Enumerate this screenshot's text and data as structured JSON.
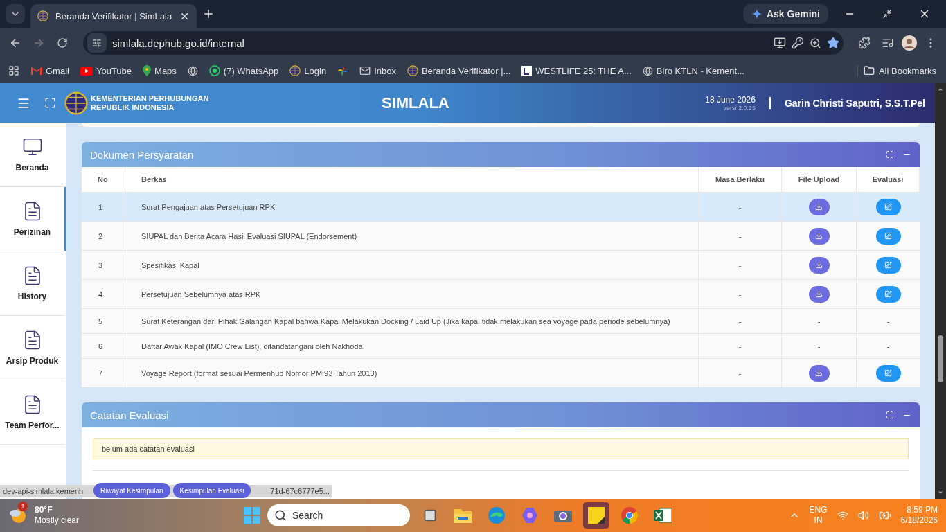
{
  "browser": {
    "tabs": [
      {
        "title": "Beranda Verifikator | SimLala",
        "selected": true
      }
    ],
    "url": "simlala.dephub.go.id/internal",
    "ask_gemini": "Ask Gemini",
    "bookmarks": [
      {
        "label": "Gmail",
        "kind": "gmail"
      },
      {
        "label": "YouTube",
        "kind": "youtube"
      },
      {
        "label": "Maps",
        "kind": "maps"
      },
      {
        "kind": "globe"
      },
      {
        "label": "(7) WhatsApp",
        "kind": "whatsapp"
      },
      {
        "label": "Login",
        "kind": "emblem"
      },
      {
        "kind": "pinwheel"
      },
      {
        "label": "Inbox",
        "kind": "mail"
      },
      {
        "label": "Beranda Verifikator |...",
        "kind": "emblem"
      },
      {
        "label": "WESTLIFE 25: THE A...",
        "kind": "square"
      },
      {
        "label": "Biro KTLN - Kement...",
        "kind": "globe"
      }
    ],
    "all_bookmarks": "All Bookmarks"
  },
  "header": {
    "org": [
      "KEMENTERIAN PERHUBUNGAN",
      "REPUBLIK INDONESIA"
    ],
    "title": "SIMLALA",
    "date": "18 June 2026",
    "version": "versi 2.0.25",
    "user": "Garin Christi Saputri, S.S.T.Pel"
  },
  "sidebar": {
    "items": [
      {
        "label": "Beranda",
        "kind": "monitor",
        "selected": false
      },
      {
        "label": "Perizinan",
        "kind": "doc",
        "selected": true
      },
      {
        "label": "History",
        "kind": "doc",
        "selected": false
      },
      {
        "label": "Arsip Produk",
        "kind": "doc",
        "selected": false
      },
      {
        "label": "Team Perfor...",
        "kind": "doc",
        "selected": false
      }
    ]
  },
  "documents": {
    "title": "Dokumen Persyaratan",
    "columns": [
      "No",
      "Berkas",
      "Masa Berlaku",
      "File Upload",
      "Evaluasi"
    ],
    "rows": [
      {
        "no": "1",
        "berkas": "Surat Pengajuan atas Persetujuan RPK",
        "masa": "-",
        "kind": "action",
        "selected": true
      },
      {
        "no": "2",
        "berkas": "SIUPAL dan Berita Acara Hasil Evaluasi SIUPAL (Endorsement)",
        "masa": "-",
        "kind": "action",
        "selected": false
      },
      {
        "no": "3",
        "berkas": "Spesifikasi Kapal",
        "masa": "-",
        "kind": "action",
        "selected": false
      },
      {
        "no": "4",
        "berkas": "Persetujuan Sebelumnya atas RPK",
        "masa": "-",
        "kind": "action",
        "selected": false
      },
      {
        "no": "5",
        "berkas": "Surat Keterangan dari Pihak Galangan Kapal bahwa Kapal Melakukan Docking / Laid Up (Jika kapal tidak melakukan sea voyage pada periode sebelumnya)",
        "masa": "-",
        "kind": "none",
        "file_upload": "-",
        "evaluasi": "-",
        "selected": false
      },
      {
        "no": "6",
        "berkas": "Daftar Awak Kapal (IMO Crew List), ditandatangani oleh Nakhoda",
        "masa": "-",
        "kind": "none",
        "file_upload": "-",
        "evaluasi": "-",
        "selected": false
      },
      {
        "no": "7",
        "berkas": "Voyage Report (format sesuai Permenhub Nomor PM 93 Tahun 2013)",
        "masa": "-",
        "kind": "action",
        "selected": false
      }
    ]
  },
  "notes": {
    "title": "Catatan Evaluasi",
    "message": "belum ada catatan evaluasi",
    "buttons": [
      "Riwayat Kesimpulan",
      "Kesimpulan Evaluasi"
    ]
  },
  "status_url": [
    "dev-api-simlala.kemenh",
    "71d-67c6777e5..."
  ],
  "taskbar": {
    "weather_badge": "1",
    "temperature": "80°F",
    "condition": "Mostly clear",
    "search": "Search",
    "apps": [
      {
        "kind": "explorer",
        "selected": false
      },
      {
        "kind": "edge",
        "selected": false
      },
      {
        "kind": "copilot",
        "selected": false
      },
      {
        "kind": "camera",
        "selected": false
      },
      {
        "kind": "sticky",
        "selected": true
      },
      {
        "kind": "chrome",
        "selected": false
      },
      {
        "kind": "excel",
        "selected": false
      }
    ],
    "language": [
      "ENG",
      "IN"
    ],
    "time": "8:59 PM",
    "date": "6/18/2026"
  }
}
